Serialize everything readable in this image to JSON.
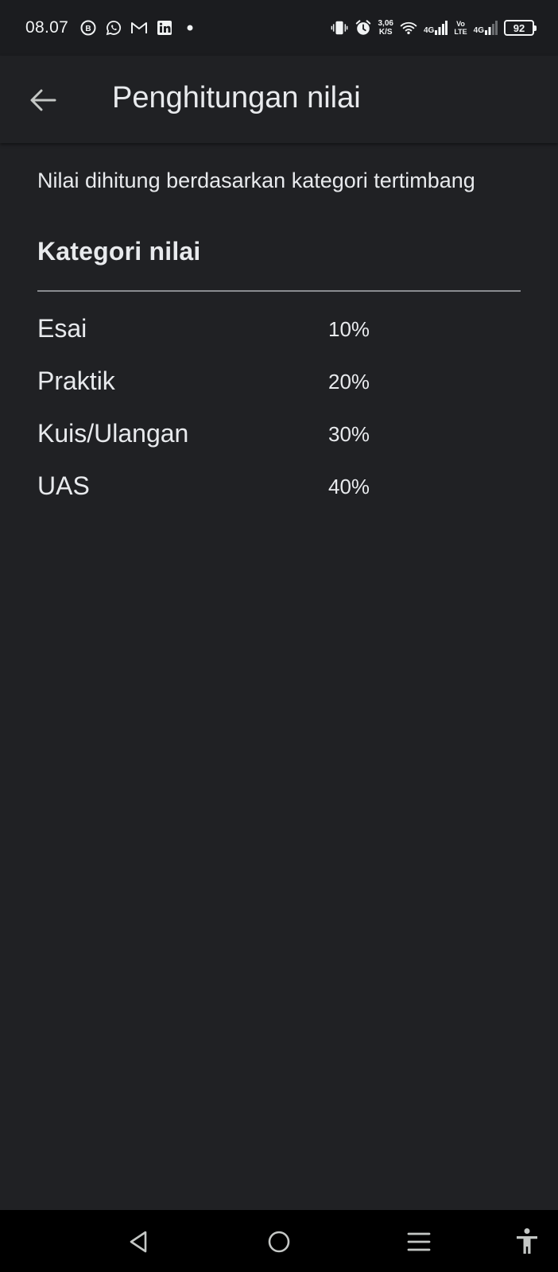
{
  "status_bar": {
    "time": "08.07",
    "notification_icons": [
      "business-chat-icon",
      "whatsapp-icon",
      "gmail-icon",
      "linkedin-icon",
      "more-dot-icon"
    ],
    "speed_value": "3,06",
    "speed_unit": "K/S",
    "network1": "4G",
    "volte_top": "Vo",
    "volte_bottom": "LTE",
    "network2": "4G",
    "battery": "92"
  },
  "app_bar": {
    "title": "Penghitungan nilai"
  },
  "content": {
    "description": "Nilai dihitung berdasarkan kategori tertimbang",
    "section_title": "Kategori nilai",
    "categories": [
      {
        "label": "Esai",
        "value": "10%"
      },
      {
        "label": "Praktik",
        "value": "20%"
      },
      {
        "label": "Kuis/Ulangan",
        "value": "30%"
      },
      {
        "label": "UAS",
        "value": "40%"
      }
    ]
  },
  "nav_bar": {
    "buttons": [
      "back-nav-icon",
      "home-nav-icon",
      "recents-nav-icon",
      "accessibility-icon"
    ]
  },
  "colors": {
    "background": "#202124",
    "status_bar": "#1b1c1f",
    "text": "#e8eaed",
    "divider": "#8a8c90",
    "nav_bar": "#000000"
  }
}
